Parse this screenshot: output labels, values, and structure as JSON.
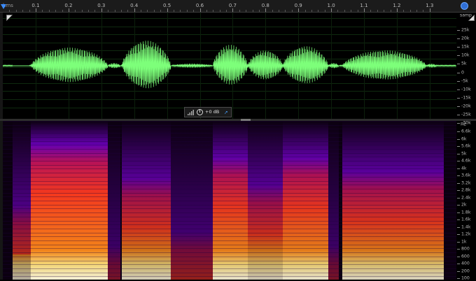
{
  "time_ruler": {
    "unit": "hms",
    "labels": [
      "0.1",
      "0.2",
      "0.3",
      "0.4",
      "0.5",
      "0.6",
      "0.7",
      "0.8",
      "0.9",
      "1.0",
      "1.1",
      "1.2",
      "1.3"
    ]
  },
  "waveform": {
    "scale_unit": "samp",
    "scale_labels": [
      "25k",
      "20k",
      "15k",
      "10k",
      "5k",
      "0",
      "-5k",
      "-10k",
      "-15k",
      "-20k",
      "-25k",
      "-30k"
    ],
    "color": "#7dff7a"
  },
  "toolbar": {
    "gain_label": "+0 dB",
    "icons": [
      "signal-strength-icon",
      "gain-knob-icon",
      "pin-icon"
    ]
  },
  "spectrogram": {
    "scale_unit": "Hz",
    "scale_labels": [
      "6.6k",
      "6k",
      "5.6k",
      "5k",
      "4.6k",
      "4k",
      "3.6k",
      "3.2k",
      "2.8k",
      "2.4k",
      "2k",
      "1.8k",
      "1.6k",
      "1.4k",
      "1.2k",
      "1k",
      "800",
      "600",
      "400",
      "200",
      "100"
    ],
    "colormap": [
      "#0b0010",
      "#2a0060",
      "#6a00b8",
      "#c0135a",
      "#ff3b1f",
      "#ff8a1a",
      "#ffe07a",
      "#fffbe0"
    ]
  }
}
